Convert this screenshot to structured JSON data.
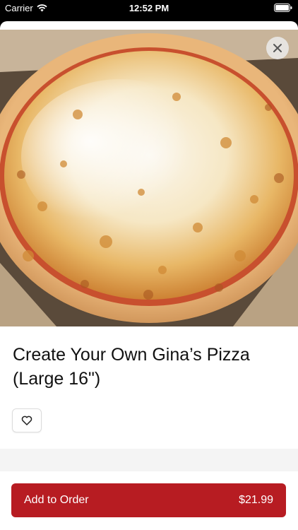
{
  "status_bar": {
    "carrier": "Carrier",
    "time": "12:52 PM"
  },
  "product": {
    "title": "Create Your Own Gina’s Pizza (Large 16\")",
    "image": "cheese-pizza-photo"
  },
  "actions": {
    "add_to_order_label": "Add to Order",
    "price": "$21.99"
  },
  "colors": {
    "accent": "#b71c22",
    "background": "#ffffff",
    "divider": "#f4f4f4"
  },
  "icons": [
    "wifi-icon",
    "battery-icon",
    "close-icon",
    "heart-icon"
  ]
}
